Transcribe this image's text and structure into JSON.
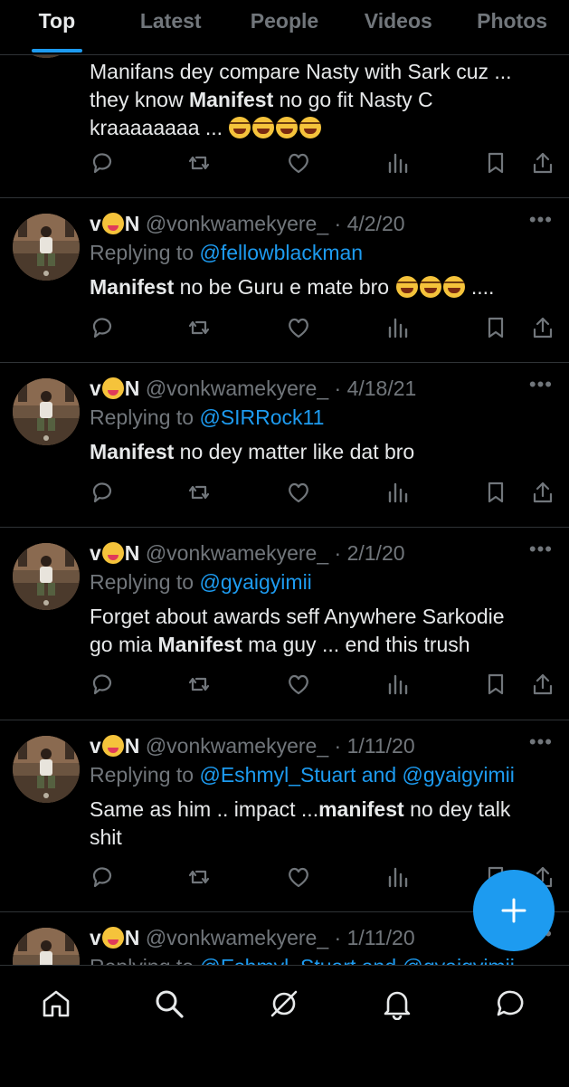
{
  "tabs": [
    {
      "label": "Top",
      "active": true
    },
    {
      "label": "Latest",
      "active": false
    },
    {
      "label": "People",
      "active": false
    },
    {
      "label": "Videos",
      "active": false
    },
    {
      "label": "Photos",
      "active": false
    }
  ],
  "top_tweet": {
    "body_line1": "Manifans dey compare Nasty with Sark cuz ...",
    "body_line2_pre": "they know ",
    "body_line2_bold": "Manifest",
    "body_line2_post": " no go fit Nasty C",
    "body_line3": "kraaaaaaaa ... "
  },
  "tweets": [
    {
      "name_pre": "v",
      "name_post": "N",
      "handle": "@vonkwamekyere_",
      "date": "· 4/2/20",
      "replying_label": "Replying to ",
      "replying_to": "@fellowblackman",
      "body_bold": "Manifest",
      "body_rest": " no be Guru e mate bro ",
      "body_tail": " ...."
    },
    {
      "name_pre": "v",
      "name_post": "N",
      "handle": "@vonkwamekyere_",
      "date": "· 4/18/21",
      "replying_label": "Replying to ",
      "replying_to": "@SIRRock11",
      "body_bold": "Manifest",
      "body_rest": " no dey matter like dat bro"
    },
    {
      "name_pre": "v",
      "name_post": "N",
      "handle": "@vonkwamekyere_",
      "date": "· 2/1/20",
      "replying_label": "Replying to ",
      "replying_to": "@gyaigyimii",
      "body_line1": "Forget about awards seff Anywhere Sarkodie",
      "body_line2_pre": "go mia ",
      "body_line2_bold": "Manifest",
      "body_line2_post": " ma guy ... end this trush"
    },
    {
      "name_pre": "v",
      "name_post": "N",
      "handle": "@vonkwamekyere_",
      "date": "· 1/11/20",
      "replying_label": "Replying to ",
      "replying_to": "@Eshmyl_Stuart and @gyaigyimii",
      "body_pre": "Same as him .. impact ...",
      "body_bold": "manifest",
      "body_post": " no dey talk",
      "body_line2": "shit"
    },
    {
      "name_pre": "v",
      "name_post": "N",
      "handle": "@vonkwamekyere_",
      "date": "· 1/11/20",
      "replying_label": "Replying to ",
      "replying_to": "@Eshmyl_Stuart and @gyaigyimii"
    }
  ],
  "more_label": "•••",
  "icons": {
    "reply": "reply-icon",
    "retweet": "retweet-icon",
    "like": "heart-icon",
    "views": "views-icon",
    "bookmark": "bookmark-icon",
    "share": "share-icon",
    "compose": "plus-icon"
  },
  "bottom_nav": [
    "home-icon",
    "search-icon",
    "grok-icon",
    "notifications-icon",
    "messages-icon"
  ],
  "colors": {
    "accent": "#1d9bf0",
    "background": "#000000",
    "text": "#e7e9ea",
    "muted": "#71767b"
  }
}
